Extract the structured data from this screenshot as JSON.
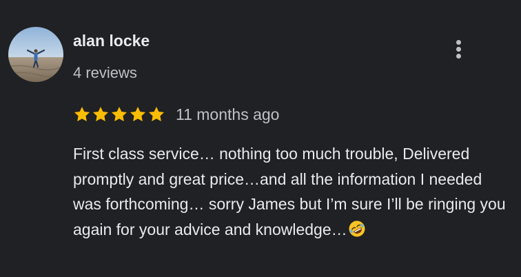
{
  "review": {
    "reviewer": {
      "name": "alan locke",
      "review_count": "4 reviews",
      "avatar_icon": "profile-photo"
    },
    "menu_icon": "more-vert-icon",
    "rating": 5,
    "rating_max": 5,
    "star_color": "#fbbc04",
    "date": "11 months ago",
    "text": "First class service… nothing too much trouble, Delivered promptly and great price…and all the information I needed was forthcoming… sorry James but I’m sure I’ll be ringing you again for your advice and knowledge…",
    "trailing_emoji": "rolling-on-floor-laughing-emoji"
  },
  "theme": {
    "background": "#202124",
    "primary_text": "#e8eaed",
    "secondary_text": "#bdc1c6"
  }
}
